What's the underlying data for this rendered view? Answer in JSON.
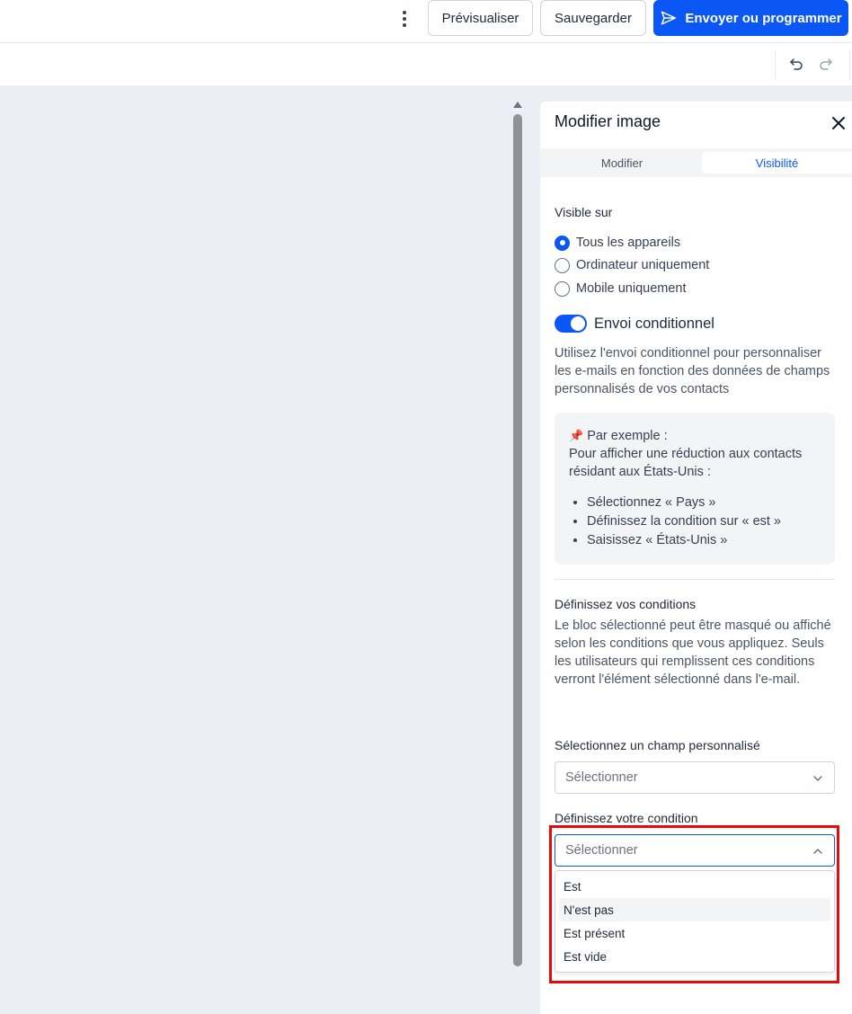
{
  "header": {
    "more_icon": "vertical-dots-icon",
    "preview_label": "Prévisualiser",
    "save_label": "Sauvegarder",
    "send_label": "Envoyer ou programmer",
    "send_icon": "paper-plane-icon",
    "accent_color": "#0b57f5"
  },
  "toolbar": {
    "undo_icon": "undo-icon",
    "redo_icon": "redo-icon"
  },
  "panel": {
    "title": "Modifier image",
    "close_icon": "close-icon",
    "tabs": [
      {
        "label": "Modifier",
        "active": false
      },
      {
        "label": "Visibilité",
        "active": true
      }
    ],
    "visible_on": {
      "label": "Visible sur",
      "options": [
        {
          "label": "Tous les appareils",
          "selected": true
        },
        {
          "label": "Ordinateur uniquement",
          "selected": false
        },
        {
          "label": "Mobile uniquement",
          "selected": false
        }
      ]
    },
    "conditional": {
      "label": "Envoi conditionnel",
      "enabled": true,
      "description": "Utilisez l'envoi conditionnel pour personnaliser les e-mails en fonction des données de champs personnalisés de vos contacts"
    },
    "example": {
      "icon": "pushpin-icon",
      "title": "Par exemple :",
      "text": "Pour afficher une réduction aux contacts résidant aux États-Unis :",
      "steps": [
        "Sélectionnez « Pays »",
        "Définissez la condition sur « est »",
        "Saisissez « États-Unis »"
      ]
    },
    "conditions": {
      "heading": "Définissez vos conditions",
      "description": "Le bloc sélectionné peut être masqué ou affiché selon les conditions que vous appliquez. Seuls les utilisateurs qui remplissent ces conditions verront l'élément sélectionné dans l'e-mail."
    },
    "custom_field": {
      "label": "Sélectionnez un champ personnalisé",
      "placeholder": "Sélectionner"
    },
    "condition": {
      "label": "Définissez votre condition",
      "placeholder": "Sélectionner",
      "options": [
        "Est",
        "N'est pas",
        "Est présent",
        "Est vide"
      ],
      "hovered": "N'est pas"
    }
  },
  "annotation": {
    "highlight_color": "#e30b0b"
  }
}
